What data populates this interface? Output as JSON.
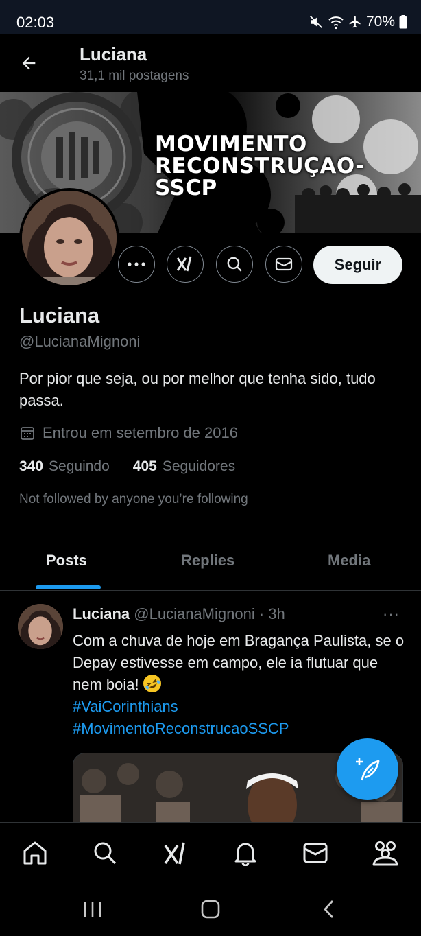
{
  "status_bar": {
    "time": "02:03",
    "battery": "70%"
  },
  "header": {
    "name": "Luciana",
    "posts_count": "31,1 mil postagens"
  },
  "banner": {
    "line1": "MOVIMENTO",
    "line2": "RECONSTRUÇAO-SSCP",
    "seal_text": "CORINTHIANS PAULISTA"
  },
  "profile": {
    "name": "Luciana",
    "handle": "@LucianaMignoni",
    "bio": "Por pior que seja, ou por melhor que tenha sido, tudo passa.",
    "joined": "Entrou em setembro de 2016",
    "following_count": "340",
    "following_label": "Seguindo",
    "followers_count": "405",
    "followers_label": "Seguidores",
    "not_followed": "Not followed by anyone you’re following",
    "follow_label": "Seguir"
  },
  "tabs": [
    {
      "label": "Posts",
      "active": true
    },
    {
      "label": "Replies",
      "active": false
    },
    {
      "label": "Media",
      "active": false
    }
  ],
  "tweet": {
    "name": "Luciana",
    "handle": "@LucianaMignoni",
    "separator": "·",
    "time": "3h",
    "more": "···",
    "text": "Com a chuva de hoje em Bragança Paulista, se o Depay estivesse em campo, ele ia flutuar que nem boia!",
    "emoji": "rolling-on-floor-laughing",
    "hashtags": [
      "#VaiCorinthians",
      "#MovimentoReconstrucaoSSCP"
    ]
  },
  "colors": {
    "accent": "#1d9bf0",
    "background": "#000000",
    "muted": "#71767b",
    "text": "#e7e9ea"
  }
}
